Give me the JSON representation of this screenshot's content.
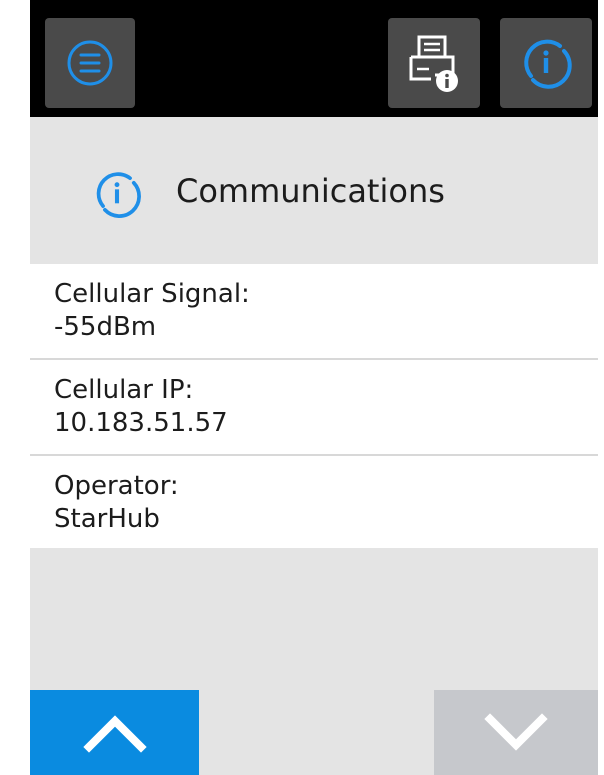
{
  "header": {
    "title": "Communications"
  },
  "items": [
    {
      "label": "Cellular Signal:",
      "value": "-55dBm"
    },
    {
      "label": "Cellular IP:",
      "value": "10.183.51.57"
    },
    {
      "label": "Operator:",
      "value": "StarHub"
    }
  ],
  "icons": {
    "menu": "menu-icon",
    "printer_info": "printer-info-icon",
    "info": "info-icon",
    "header": "info-icon",
    "scroll_up": "chevron-up-icon",
    "scroll_down": "chevron-down-icon"
  },
  "colors": {
    "accent_blue": "#1f8fe8",
    "topbar": "#000000",
    "button_gray": "#4a4a4a",
    "header_bg": "#e4e4e4",
    "scroll_up_bg": "#0a8be0",
    "scroll_down_bg": "#c6c8cc"
  }
}
